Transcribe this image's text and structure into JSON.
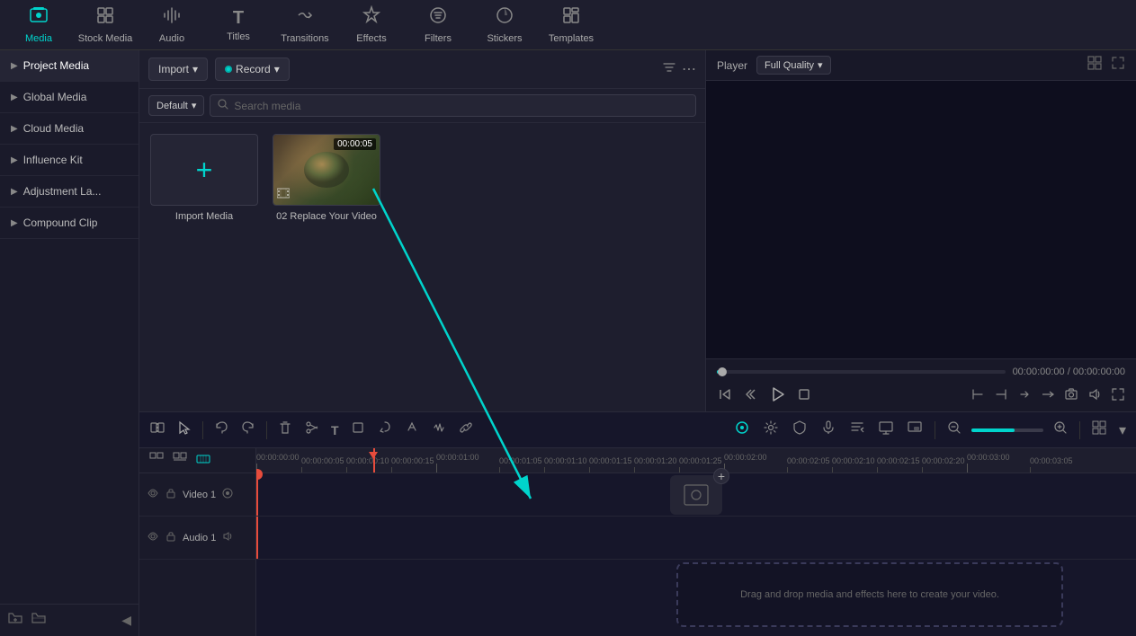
{
  "toolbar": {
    "items": [
      {
        "id": "media",
        "label": "Media",
        "icon": "🎬",
        "active": true
      },
      {
        "id": "stock",
        "label": "Stock Media",
        "icon": "🗃"
      },
      {
        "id": "audio",
        "label": "Audio",
        "icon": "🎵"
      },
      {
        "id": "titles",
        "label": "Titles",
        "icon": "T"
      },
      {
        "id": "transitions",
        "label": "Transitions",
        "icon": "⇄"
      },
      {
        "id": "effects",
        "label": "Effects",
        "icon": "✨"
      },
      {
        "id": "filters",
        "label": "Filters",
        "icon": "🎨"
      },
      {
        "id": "stickers",
        "label": "Stickers",
        "icon": "⭐"
      },
      {
        "id": "templates",
        "label": "Templates",
        "icon": "▦"
      }
    ]
  },
  "sidebar": {
    "items": [
      {
        "id": "project-media",
        "label": "Project Media",
        "active": true
      },
      {
        "id": "global-media",
        "label": "Global Media"
      },
      {
        "id": "cloud-media",
        "label": "Cloud Media"
      },
      {
        "id": "influence-kit",
        "label": "Influence Kit"
      },
      {
        "id": "adjustment-la",
        "label": "Adjustment La..."
      },
      {
        "id": "compound-clip",
        "label": "Compound Clip"
      }
    ]
  },
  "media_panel": {
    "import_label": "Import",
    "record_label": "Record",
    "default_label": "Default",
    "search_placeholder": "Search media",
    "items": [
      {
        "id": "import",
        "type": "import",
        "label": "Import Media"
      },
      {
        "id": "video1",
        "type": "video",
        "label": "02 Replace Your Video",
        "duration": "00:00:05"
      }
    ]
  },
  "player": {
    "label": "Player",
    "quality": "Full Quality",
    "time_current": "00:00:00:00",
    "time_total": "00:00:00:00"
  },
  "timeline": {
    "tracks": [
      {
        "id": "video1",
        "label": "Video 1"
      },
      {
        "id": "audio1",
        "label": "Audio 1"
      }
    ],
    "drop_zone_text": "Drag and drop media and effects here to create your video.",
    "rulers": [
      "00:00:00:00",
      "00:00:00:05",
      "00:00:00:10",
      "00:00:00:15",
      "00:00:01:00",
      "00:00:01:05",
      "00:00:01:10",
      "00:00:01:15",
      "00:00:01:20",
      "00:00:01:25",
      "00:00:02:00",
      "00:00:02:05",
      "00:00:02:10",
      "00:00:02:15",
      "00:00:02:20",
      "00:00:03:00",
      "00:00:03:05"
    ]
  }
}
